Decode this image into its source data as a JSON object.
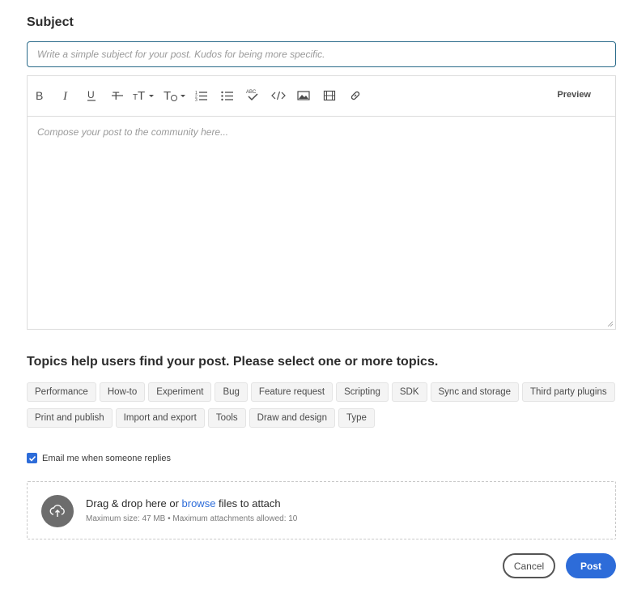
{
  "subject": {
    "label": "Subject",
    "placeholder": "Write a simple subject for your post. Kudos for being more specific."
  },
  "editor": {
    "toolbar": [
      {
        "name": "bold-icon"
      },
      {
        "name": "italic-icon"
      },
      {
        "name": "underline-icon"
      },
      {
        "name": "strikethrough-icon"
      },
      {
        "name": "font-size-icon"
      },
      {
        "name": "text-style-icon"
      },
      {
        "name": "numbered-list-icon"
      },
      {
        "name": "bullet-list-icon"
      },
      {
        "name": "spellcheck-icon"
      },
      {
        "name": "code-icon"
      },
      {
        "name": "image-icon"
      },
      {
        "name": "video-icon"
      },
      {
        "name": "link-icon"
      }
    ],
    "preview_label": "Preview",
    "compose_placeholder": "Compose your post to the community here..."
  },
  "topics": {
    "label": "Topics help users find your post. Please select one or more topics.",
    "row1": [
      "Performance",
      "How-to",
      "Experiment",
      "Bug",
      "Feature request",
      "Scripting",
      "SDK",
      "Sync and storage",
      "Third party plugins"
    ],
    "row2": [
      "Print and publish",
      "Import and export",
      "Tools",
      "Draw and design",
      "Type"
    ]
  },
  "email": {
    "label": "Email me when someone replies",
    "checked": true
  },
  "attach": {
    "main_before": "Drag & drop here or ",
    "browse": "browse",
    "main_after": " files to attach",
    "sub": "Maximum size: 47 MB • Maximum attachments allowed: 10"
  },
  "actions": {
    "cancel": "Cancel",
    "post": "Post"
  },
  "colors": {
    "accent": "#2d6cd9",
    "input_border": "#2a6b8a"
  }
}
